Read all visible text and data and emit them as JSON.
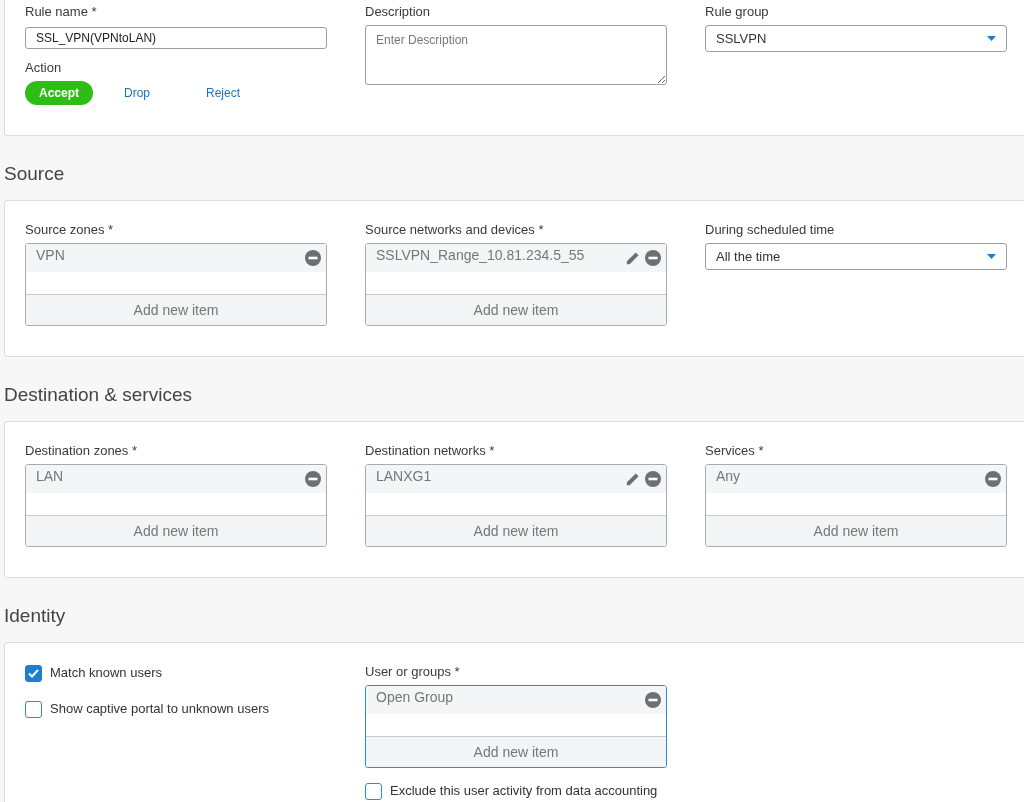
{
  "general": {
    "columns": [
      [
        {
          "kind": "text",
          "label": "Rule name *",
          "value": "SSL_VPN(VPNtoLAN)"
        },
        {
          "kind": "segmented",
          "label": "Action",
          "options": [
            {
              "label": "Accept",
              "selected": true
            },
            {
              "label": "Drop",
              "selected": false
            },
            {
              "label": "Reject",
              "selected": false
            }
          ]
        }
      ],
      [
        {
          "kind": "textarea",
          "label": "Description",
          "placeholder": "Enter Description"
        }
      ],
      [
        {
          "kind": "select",
          "label": "Rule group",
          "value": "SSLVPN"
        }
      ]
    ]
  },
  "sections": [
    {
      "title": "Source",
      "columns": [
        [
          {
            "kind": "list",
            "label": "Source zones *",
            "items": [
              {
                "text": "VPN",
                "editable": false
              }
            ],
            "add_label": "Add new item",
            "focused": false
          }
        ],
        [
          {
            "kind": "list",
            "label": "Source networks and devices *",
            "items": [
              {
                "text": "SSLVPN_Range_10.81.234.5_55",
                "editable": true
              }
            ],
            "add_label": "Add new item",
            "focused": false
          }
        ],
        [
          {
            "kind": "select",
            "label": "During scheduled time",
            "value": "All the time"
          }
        ]
      ]
    },
    {
      "title": "Destination & services",
      "columns": [
        [
          {
            "kind": "list",
            "label": "Destination zones *",
            "items": [
              {
                "text": "LAN",
                "editable": false
              }
            ],
            "add_label": "Add new item",
            "focused": false
          }
        ],
        [
          {
            "kind": "list",
            "label": "Destination networks *",
            "items": [
              {
                "text": "LANXG1",
                "editable": true
              }
            ],
            "add_label": "Add new item",
            "focused": false
          }
        ],
        [
          {
            "kind": "list",
            "label": "Services *",
            "items": [
              {
                "text": "Any",
                "editable": false
              }
            ],
            "add_label": "Add new item",
            "focused": false
          }
        ]
      ]
    },
    {
      "title": "Identity",
      "columns": [
        [
          {
            "kind": "checkbox",
            "label": "Match known users",
            "checked": true
          },
          {
            "kind": "checkbox",
            "label": "Show captive portal to unknown users",
            "checked": false
          }
        ],
        [
          {
            "kind": "list",
            "label": "User or groups *",
            "items": [
              {
                "text": "Open Group",
                "editable": false
              }
            ],
            "add_label": "Add new item",
            "focused": true
          },
          {
            "kind": "checkbox",
            "label": "Exclude this user activity from data accounting",
            "checked": false
          }
        ],
        []
      ]
    }
  ]
}
